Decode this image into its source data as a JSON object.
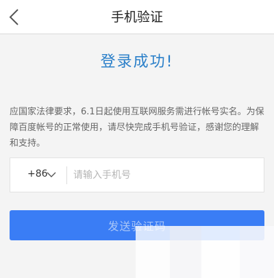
{
  "nav": {
    "title": "手机验证",
    "back_icon": "chevron-left-icon"
  },
  "main": {
    "success_title": "登录成功!",
    "notice": "应国家法律要求，6.1日起使用互联网服务需进行帐号实名。为保障百度帐号的正常使用，请尽快完成手机号验证，感谢您的理解和支持。"
  },
  "phone_form": {
    "country_code": "+86",
    "dropdown_icon": "chevron-down-icon",
    "input_value": "",
    "input_placeholder": "请输入手机号",
    "send_button_label": "发送验证码"
  },
  "colors": {
    "accent_title": "#2a7fc9",
    "button_bg": "#3a7df5",
    "button_text": "#a9c6f7",
    "page_bg": "#f4f4f4"
  }
}
